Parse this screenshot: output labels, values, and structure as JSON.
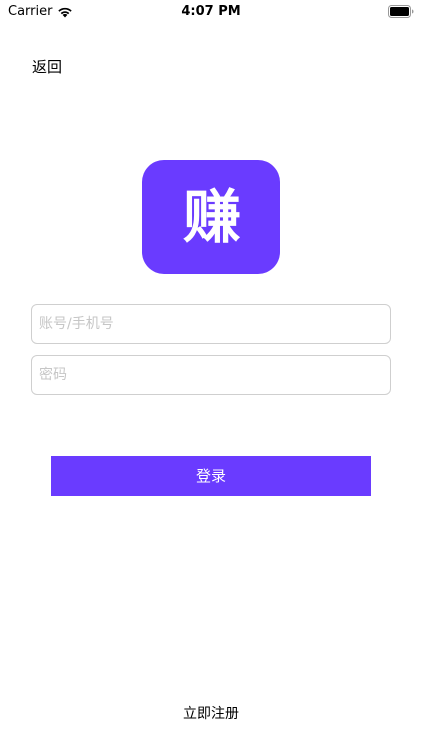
{
  "status_bar": {
    "carrier": "Carrier",
    "time": "4:07 PM",
    "wifi_icon": "wifi-icon",
    "battery_icon": "battery-full-icon"
  },
  "nav": {
    "back_label": "返回"
  },
  "logo": {
    "text": "赚",
    "color": "#6a3bff"
  },
  "form": {
    "account_placeholder": "账号/手机号",
    "account_value": "",
    "password_placeholder": "密码",
    "password_value": "",
    "login_label": "登录",
    "accent_color": "#6a3bff"
  },
  "footer": {
    "register_label": "立即注册"
  }
}
